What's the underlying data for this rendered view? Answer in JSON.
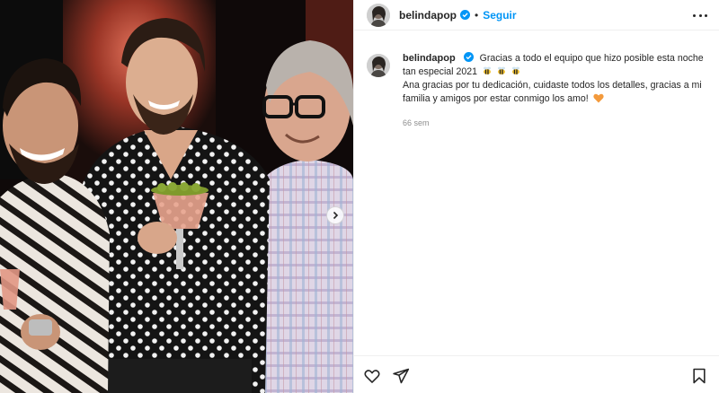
{
  "media": {
    "carousel_next_icon": "chevron-right-icon"
  },
  "header": {
    "username": "belindapop",
    "separator": "•",
    "follow_label": "Seguir",
    "more_icon": "more-options-icon"
  },
  "caption": {
    "username": "belindapop",
    "line1": "Gracias a todo el equipo que hizo posible esta noche tan especial 2021",
    "emoji_bees_count": 3,
    "line2": "Ana gracias por tu dedicación, cuidaste todos los detalles, gracias a mi familia y amigos por estar conmigo los amo!",
    "emoji_end": "orange-heart",
    "time": "66 sem"
  },
  "actions": {
    "like_icon": "heart-outline-icon",
    "share_icon": "paper-plane-icon",
    "save_icon": "bookmark-icon"
  },
  "colors": {
    "accent": "#0095f6",
    "verified": "#0095f6",
    "muted": "#8e8e8e",
    "heart": "#f39a3c"
  }
}
